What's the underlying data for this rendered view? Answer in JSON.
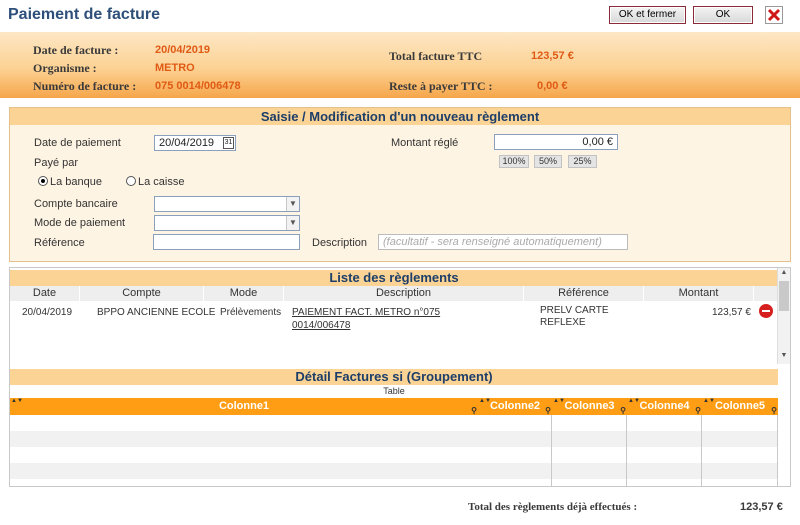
{
  "window": {
    "title": "Paiement de facture",
    "btn_ok_close": "OK et fermer",
    "btn_ok": "OK"
  },
  "header": {
    "date_label": "Date de facture :",
    "date_value": "20/04/2019",
    "org_label": "Organisme :",
    "org_value": "METRO",
    "num_label": "Numéro de facture :",
    "num_value": "075 0014/006478",
    "total_label": "Total facture TTC",
    "total_value": "123,57 €",
    "reste_label": "Reste à payer TTC :",
    "reste_value": "0,00 €"
  },
  "form": {
    "section_title": "Saisie / Modification d'un nouveau règlement",
    "date_label": "Date de paiement",
    "date_value": "20/04/2019",
    "montant_label": "Montant réglé",
    "montant_value": "0,00 €",
    "pct_buttons": [
      "100%",
      "50%",
      "25%"
    ],
    "paye_par_label": "Payé par",
    "radio_banque": "La banque",
    "radio_caisse": "La caisse",
    "selected_radio": "banque",
    "compte_label": "Compte bancaire",
    "mode_label": "Mode de paiement",
    "ref_label": "Référence",
    "desc_label": "Description",
    "desc_placeholder": "(facultatif - sera renseigné automatiquement)"
  },
  "reglements": {
    "title": "Liste des règlements",
    "columns": [
      "Date",
      "Compte",
      "Mode",
      "Description",
      "Référence",
      "Montant"
    ],
    "rows": [
      {
        "date": "20/04/2019",
        "compte": "BPPO ANCIENNE ECOLE",
        "mode": "Prélèvements",
        "desc_line1": "PAIEMENT FACT. METRO n°075",
        "desc_line2": "0014/006478",
        "ref_line1": "PRELV CARTE",
        "ref_line2": "REFLEXE",
        "montant": "123,57 €"
      }
    ]
  },
  "detail": {
    "title": "Détail Factures si (Groupement)",
    "table_caption": "Table",
    "columns": [
      "Colonne1",
      "Colonne2",
      "Colonne3",
      "Colonne4",
      "Colonne5"
    ]
  },
  "footer": {
    "total_label": "Total des règlements déjà effectués :",
    "total_value": "123,57 €"
  },
  "colors": {
    "title_blue": "#2e4f7a",
    "accent_orange": "#e05a14",
    "band_orange": "#fbd394",
    "grid_orange": "#ff9e14"
  }
}
